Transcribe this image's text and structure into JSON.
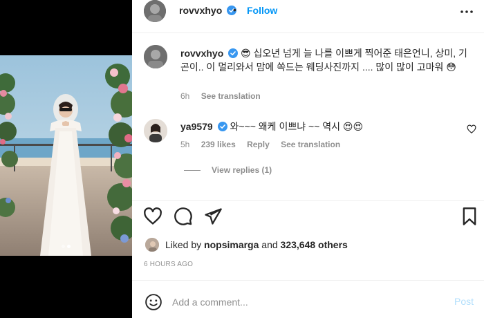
{
  "post": {
    "username": "rovvxhyo",
    "separator": "•",
    "follow_label": "Follow"
  },
  "media": {
    "carousel_count": 2,
    "active_index": 1
  },
  "caption": {
    "username": "rovvxhyo",
    "text": "😎 십오년 넘게 늘 나를 이쁘게 찍어준 태은언니, 상미, 기곤이.. 이 멀리와서 맘에 쏙드는 웨딩사진까지 .... 많이 많이 고마워 😳",
    "age": "6h",
    "see_translation": "See translation"
  },
  "comment": {
    "username": "ya9579",
    "text": "와~~~ 왜케 이쁘냐 ~~ 역시 😍😍",
    "age": "5h",
    "likes": "239 likes",
    "reply": "Reply",
    "see_translation": "See translation",
    "view_replies": "View replies (1)"
  },
  "likes": {
    "prefix": "Liked by",
    "by": "nopsimarga",
    "and": "and",
    "others": "323,648 others"
  },
  "timestamp": "6 HOURS AGO",
  "composer": {
    "placeholder": "Add a comment...",
    "post_label": "Post"
  },
  "colors": {
    "accent": "#0095f6",
    "post_disabled": "#b2dffc",
    "muted": "#8e8e8e",
    "verified": "#3897f0"
  },
  "icons": [
    "verified-icon",
    "more-icon",
    "heart-icon",
    "comment-icon",
    "share-icon",
    "bookmark-icon",
    "emoji-icon"
  ]
}
